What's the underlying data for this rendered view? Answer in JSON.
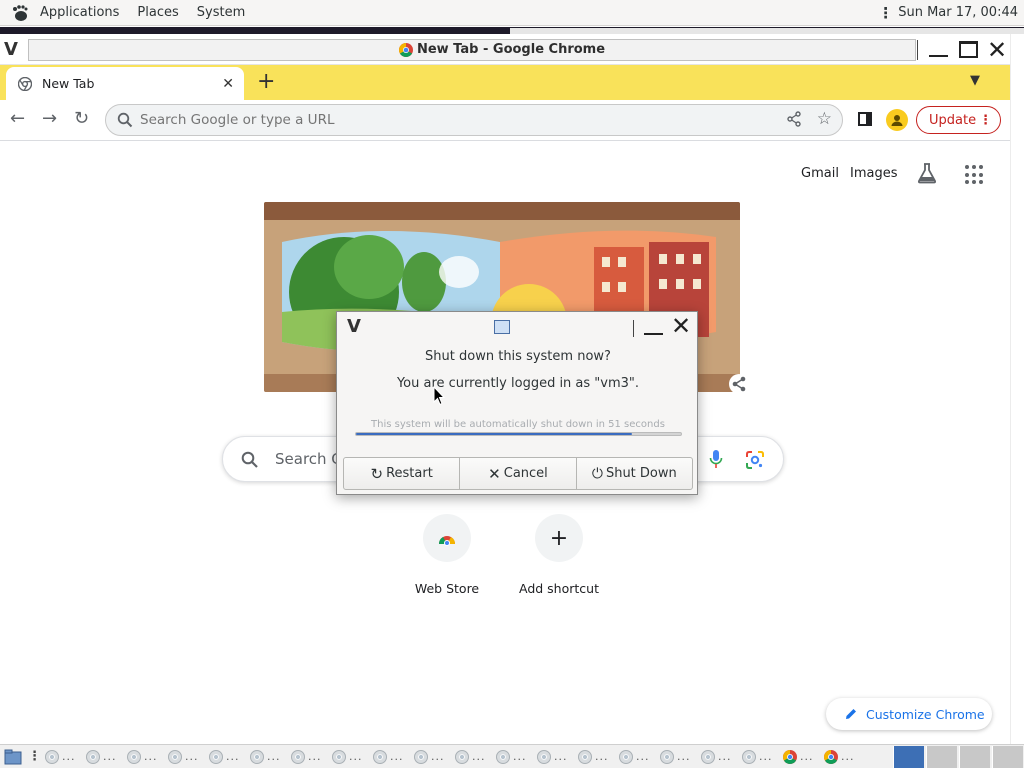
{
  "top_panel": {
    "menus": [
      "Applications",
      "Places",
      "System"
    ],
    "clock": "Sun Mar 17, 00:44"
  },
  "window": {
    "title": "New Tab - Google Chrome"
  },
  "tabs": [
    {
      "label": "New Tab"
    }
  ],
  "toolbar": {
    "omnibox_placeholder": "Search Google or type a URL",
    "update_label": "Update"
  },
  "page": {
    "top_links": [
      "Gmail",
      "Images"
    ],
    "search_placeholder": "Search G",
    "shortcuts": [
      {
        "label": "Web Store"
      },
      {
        "label": "Add shortcut"
      }
    ],
    "customize_label": "Customize Chrome"
  },
  "dialog": {
    "question": "Shut down this system now?",
    "logged_in": "You are currently logged in as \"vm3\".",
    "auto_msg": "This system will be automatically shut down in 51 seconds",
    "progress_fraction": 0.85,
    "buttons": [
      "Restart",
      "Cancel",
      "Shut Down"
    ]
  },
  "taskbar": {
    "ellipsis": "..."
  },
  "colors": {
    "tab_strip": "#f9e25a",
    "update_red": "#c5221f",
    "link_blue": "#1a73e8",
    "progress_blue": "#3a6cc0"
  }
}
